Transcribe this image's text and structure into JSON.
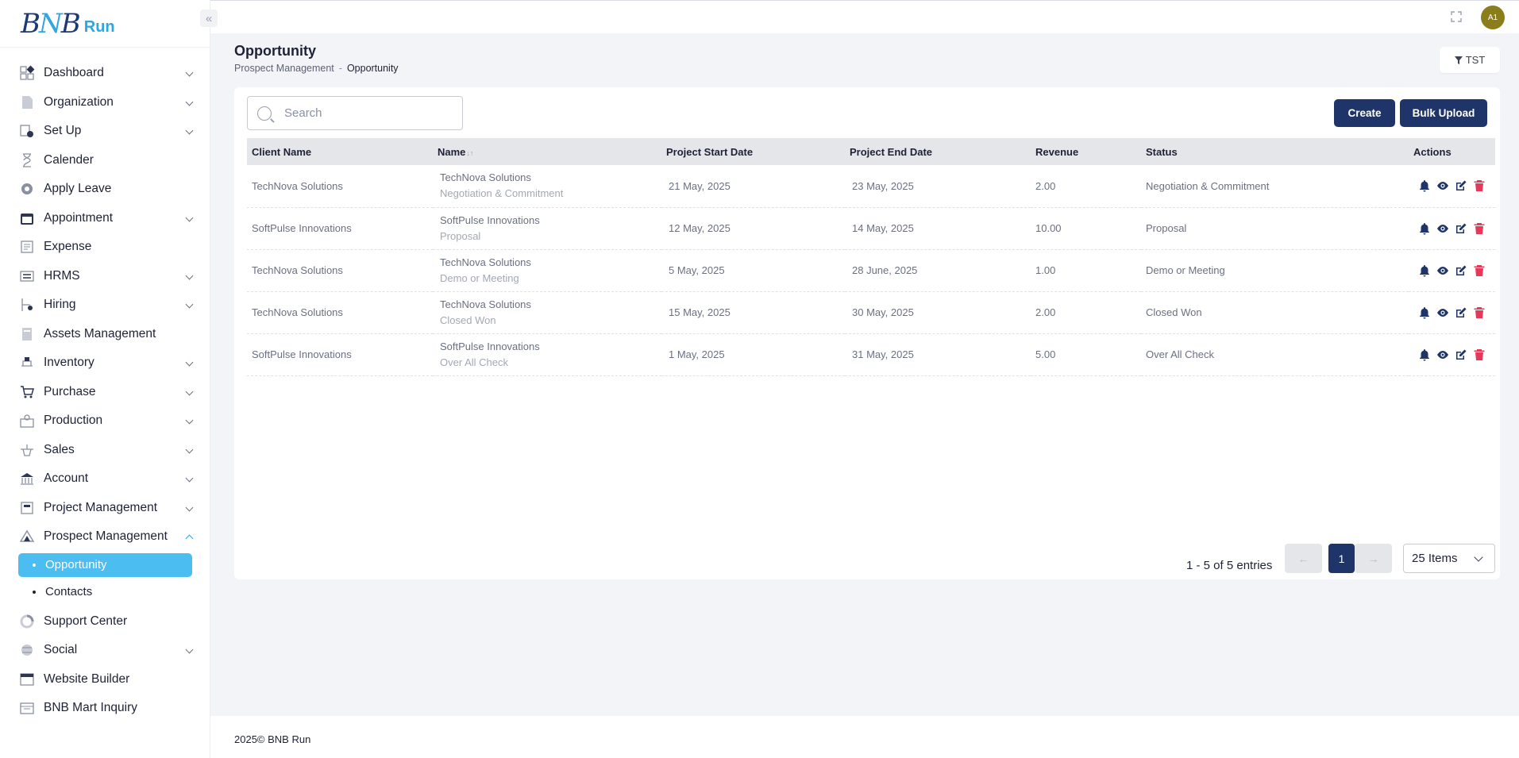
{
  "brand": {
    "logo_text": "BNB",
    "logo_run": "Run"
  },
  "sidebar": {
    "items": [
      {
        "label": "Dashboard",
        "icon": "dashboard-icon",
        "chevron": true
      },
      {
        "label": "Organization",
        "icon": "document-icon",
        "chevron": true
      },
      {
        "label": "Set Up",
        "icon": "setup-icon",
        "chevron": true
      },
      {
        "label": "Calender",
        "icon": "hourglass-icon",
        "chevron": false
      },
      {
        "label": "Apply Leave",
        "icon": "leave-icon",
        "chevron": false
      },
      {
        "label": "Appointment",
        "icon": "calendar-icon",
        "chevron": true
      },
      {
        "label": "Expense",
        "icon": "expense-icon",
        "chevron": false
      },
      {
        "label": "HRMS",
        "icon": "hrms-icon",
        "chevron": true
      },
      {
        "label": "Hiring",
        "icon": "hiring-icon",
        "chevron": true
      },
      {
        "label": "Assets Management",
        "icon": "assets-icon",
        "chevron": false
      },
      {
        "label": "Inventory",
        "icon": "inventory-icon",
        "chevron": true
      },
      {
        "label": "Purchase",
        "icon": "purchase-icon",
        "chevron": true
      },
      {
        "label": "Production",
        "icon": "production-icon",
        "chevron": true
      },
      {
        "label": "Sales",
        "icon": "sales-icon",
        "chevron": true
      },
      {
        "label": "Account",
        "icon": "bank-icon",
        "chevron": true
      },
      {
        "label": "Project Management",
        "icon": "project-icon",
        "chevron": true
      },
      {
        "label": "Prospect Management",
        "icon": "prospect-icon",
        "chevron": true,
        "expanded": true
      }
    ],
    "sub_items": [
      {
        "label": "Opportunity",
        "active": true
      },
      {
        "label": "Contacts",
        "active": false
      }
    ],
    "items_after": [
      {
        "label": "Support Center",
        "icon": "support-icon",
        "chevron": false
      },
      {
        "label": "Social",
        "icon": "social-icon",
        "chevron": true
      },
      {
        "label": "Website Builder",
        "icon": "website-icon",
        "chevron": false
      },
      {
        "label": "BNB Mart Inquiry",
        "icon": "mart-icon",
        "chevron": false
      }
    ]
  },
  "topbar": {
    "avatar": "A1"
  },
  "page": {
    "title": "Opportunity",
    "breadcrumb": [
      "Prospect Management",
      "Opportunity"
    ],
    "breadcrumb_sep": "-",
    "filter_label": "TST"
  },
  "toolbar": {
    "search_placeholder": "Search",
    "create_label": "Create",
    "bulk_label": "Bulk Upload"
  },
  "table": {
    "headers": [
      "Client Name",
      "Name",
      "Project Start Date",
      "Project End Date",
      "Revenue",
      "Status",
      "Actions"
    ],
    "rows": [
      {
        "client": "TechNova Solutions",
        "name": "TechNova Solutions",
        "stage": "Negotiation & Commitment",
        "start": "21 May, 2025",
        "end": "23 May, 2025",
        "revenue": "2.00",
        "status": "Negotiation & Commitment"
      },
      {
        "client": "SoftPulse Innovations",
        "name": "SoftPulse Innovations",
        "stage": "Proposal",
        "start": "12 May, 2025",
        "end": "14 May, 2025",
        "revenue": "10.00",
        "status": "Proposal"
      },
      {
        "client": "TechNova Solutions",
        "name": "TechNova Solutions",
        "stage": "Demo or Meeting",
        "start": "5 May, 2025",
        "end": "28 June, 2025",
        "revenue": "1.00",
        "status": "Demo or Meeting"
      },
      {
        "client": "TechNova Solutions",
        "name": "TechNova Solutions",
        "stage": "Closed Won",
        "start": "15 May, 2025",
        "end": "30 May, 2025",
        "revenue": "2.00",
        "status": "Closed Won"
      },
      {
        "client": "SoftPulse Innovations",
        "name": "SoftPulse Innovations",
        "stage": "Over All Check",
        "start": "1 May, 2025",
        "end": "31 May, 2025",
        "revenue": "5.00",
        "status": "Over All Check"
      }
    ]
  },
  "pagination": {
    "entries": "1 - 5 of 5 entries",
    "prev": "←",
    "page": "1",
    "next": "→",
    "per_page": "25 Items"
  },
  "footer": {
    "text": "2025© BNB Run"
  },
  "colors": {
    "primary": "#1f356a",
    "accent": "#4bbdf0",
    "delete": "#e8385a"
  }
}
